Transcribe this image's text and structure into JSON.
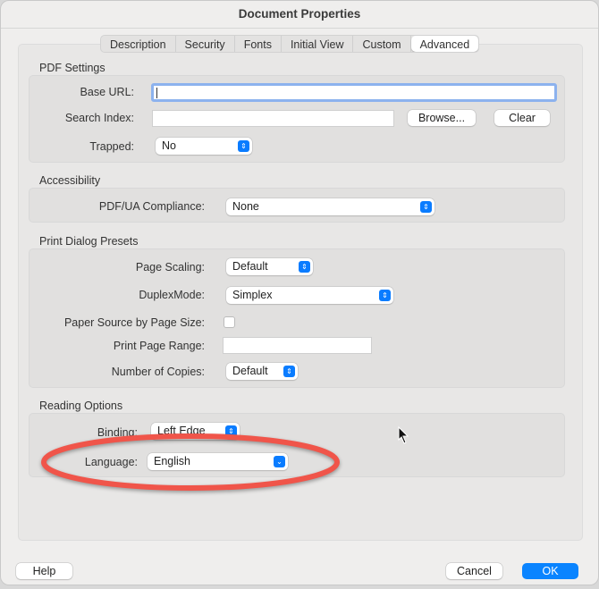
{
  "window": {
    "title": "Document Properties"
  },
  "tabs": [
    {
      "label": "Description"
    },
    {
      "label": "Security"
    },
    {
      "label": "Fonts"
    },
    {
      "label": "Initial View"
    },
    {
      "label": "Custom"
    },
    {
      "label": "Advanced",
      "active": true
    }
  ],
  "pdf_settings": {
    "heading": "PDF Settings",
    "base_url_label": "Base URL:",
    "base_url_value": "",
    "search_index_label": "Search Index:",
    "search_index_value": "",
    "browse_label": "Browse...",
    "clear_label": "Clear",
    "trapped_label": "Trapped:",
    "trapped_value": "No"
  },
  "accessibility": {
    "heading": "Accessibility",
    "compliance_label": "PDF/UA Compliance:",
    "compliance_value": "None"
  },
  "print_presets": {
    "heading": "Print Dialog Presets",
    "page_scaling_label": "Page Scaling:",
    "page_scaling_value": "Default",
    "duplex_label": "DuplexMode:",
    "duplex_value": "Simplex",
    "paper_source_label": "Paper Source by Page Size:",
    "paper_source_checked": false,
    "page_range_label": "Print Page Range:",
    "page_range_value": "",
    "copies_label": "Number of Copies:",
    "copies_value": "Default"
  },
  "reading": {
    "heading": "Reading Options",
    "binding_label": "Binding:",
    "binding_value": "Left Edge",
    "language_label": "Language:",
    "language_value": "English"
  },
  "footer": {
    "help_label": "Help",
    "cancel_label": "Cancel",
    "ok_label": "OK"
  },
  "colors": {
    "accent": "#0a84ff",
    "annotation": "#f0554a"
  }
}
